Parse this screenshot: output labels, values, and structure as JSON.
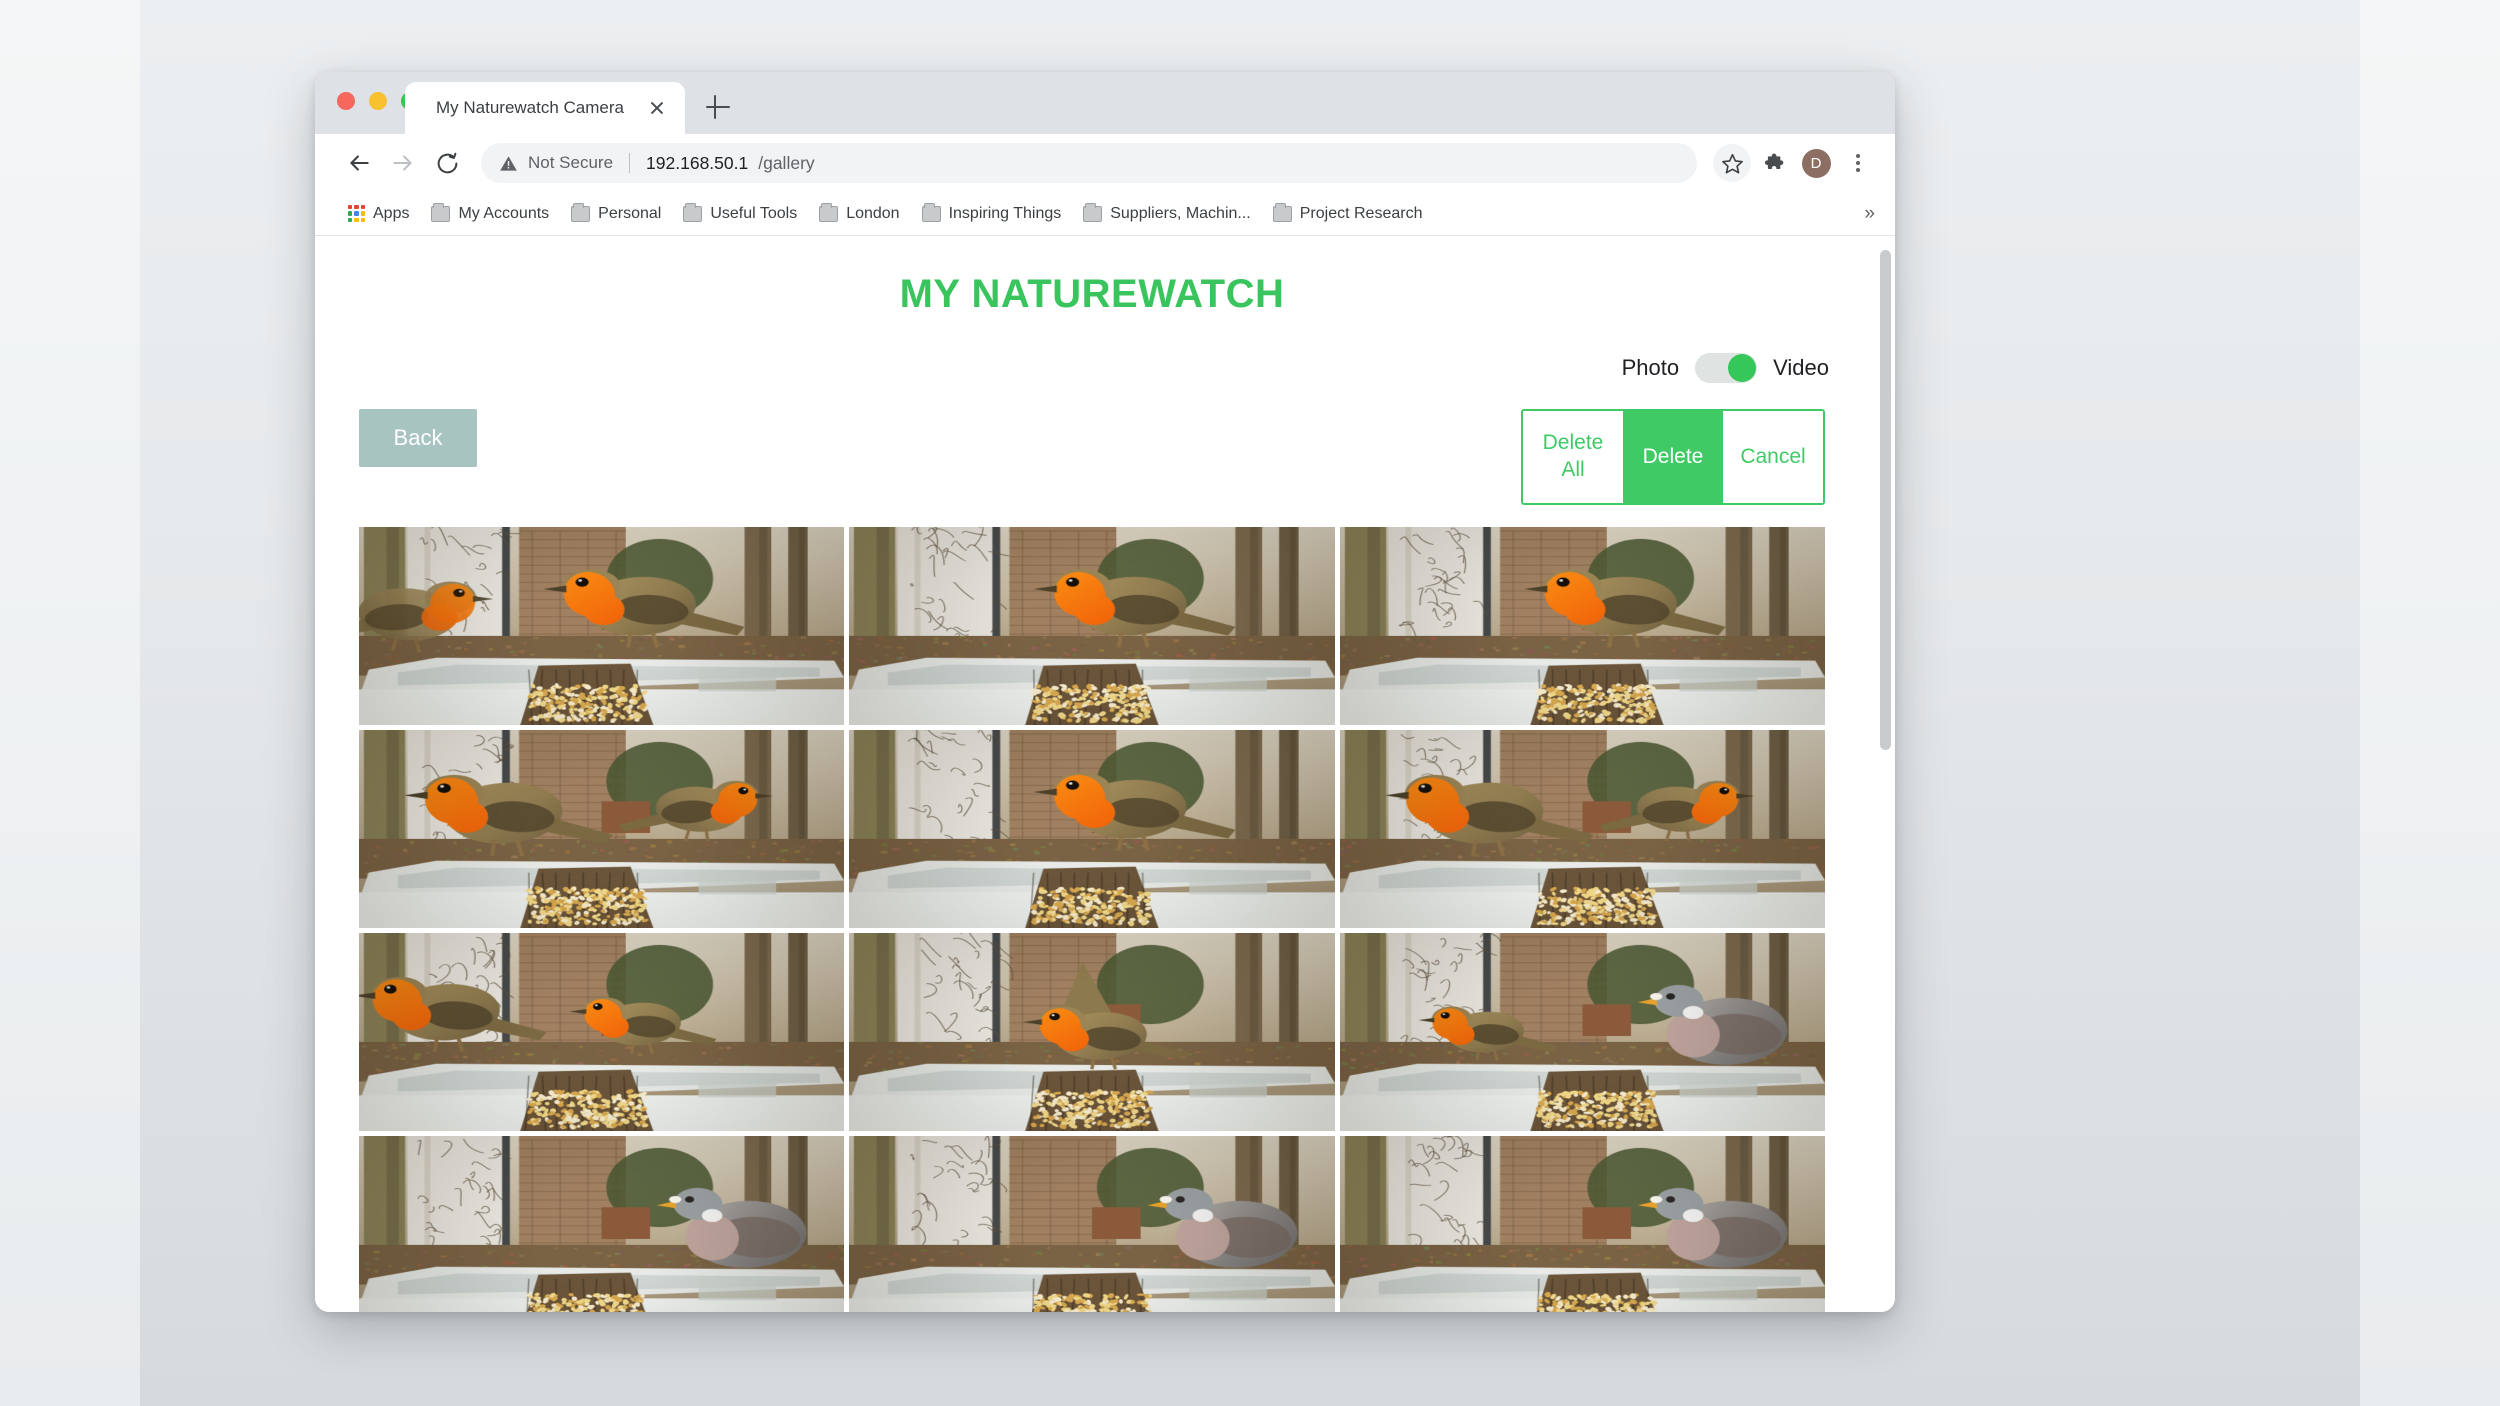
{
  "browser": {
    "tab": {
      "title": "My Naturewatch Camera",
      "close_icon": "close-icon",
      "newtab_icon": "plus-icon"
    },
    "nav": {
      "back_icon": "back-arrow-icon",
      "forward_icon": "forward-arrow-icon",
      "reload_icon": "reload-icon"
    },
    "omnibox": {
      "security_icon": "warning-triangle-icon",
      "security_text": "Not Secure",
      "url_host": "192.168.50.1",
      "url_path": "/gallery"
    },
    "toolbar_icons": {
      "bookmark_star": "star-icon",
      "extensions": "puzzle-piece-icon",
      "profile_initial": "D",
      "menu": "kebab-menu-icon"
    },
    "bookmarks": [
      {
        "label": "Apps",
        "icon": "apps-grid-icon"
      },
      {
        "label": "My Accounts",
        "icon": "folder-icon"
      },
      {
        "label": "Personal",
        "icon": "folder-icon"
      },
      {
        "label": "Useful Tools",
        "icon": "folder-icon"
      },
      {
        "label": "London",
        "icon": "folder-icon"
      },
      {
        "label": "Inspiring Things",
        "icon": "folder-icon"
      },
      {
        "label": "Suppliers, Machin...",
        "icon": "folder-icon"
      },
      {
        "label": "Project Research",
        "icon": "folder-icon"
      }
    ],
    "bookmarks_overflow": "»"
  },
  "page": {
    "title": "MY NATUREWATCH",
    "title_color": "#3ac45e",
    "media_toggle": {
      "left_label": "Photo",
      "right_label": "Video",
      "state": "video",
      "knob_color": "#35c759",
      "track_color": "#dfe4e3"
    },
    "back_button": {
      "label": "Back",
      "color": "#a8c4c1"
    },
    "delete_group": {
      "delete_all_label": "Delete All",
      "delete_label": "Delete",
      "cancel_label": "Cancel",
      "accent_color": "#3fca66"
    },
    "gallery": {
      "columns": 3,
      "tiles": [
        {
          "id": "tile-1",
          "subject": "robin-perched-on-log-facing-right"
        },
        {
          "id": "tile-2",
          "subject": "robin-upright-on-log"
        },
        {
          "id": "tile-3",
          "subject": "robin-leaning-over-seed"
        },
        {
          "id": "tile-4",
          "subject": "two-robins-left-blurred-wing"
        },
        {
          "id": "tile-5",
          "subject": "robin-side-profile-on-log"
        },
        {
          "id": "tile-6",
          "subject": "two-robins-close-up-feeding"
        },
        {
          "id": "tile-7",
          "subject": "robin-pair-on-tray"
        },
        {
          "id": "tile-8",
          "subject": "robin-wings-raised-on-log"
        },
        {
          "id": "tile-9",
          "subject": "wood-pigeon-on-tray-with-robin"
        },
        {
          "id": "tile-10",
          "subject": "wood-pigeon-partial-row-cropped"
        },
        {
          "id": "tile-11",
          "subject": "wood-pigeon-front-view-cropped"
        },
        {
          "id": "tile-12",
          "subject": "wood-pigeon-head-cropped"
        }
      ]
    },
    "scrollbar": {
      "name": "page-scrollbar"
    }
  }
}
